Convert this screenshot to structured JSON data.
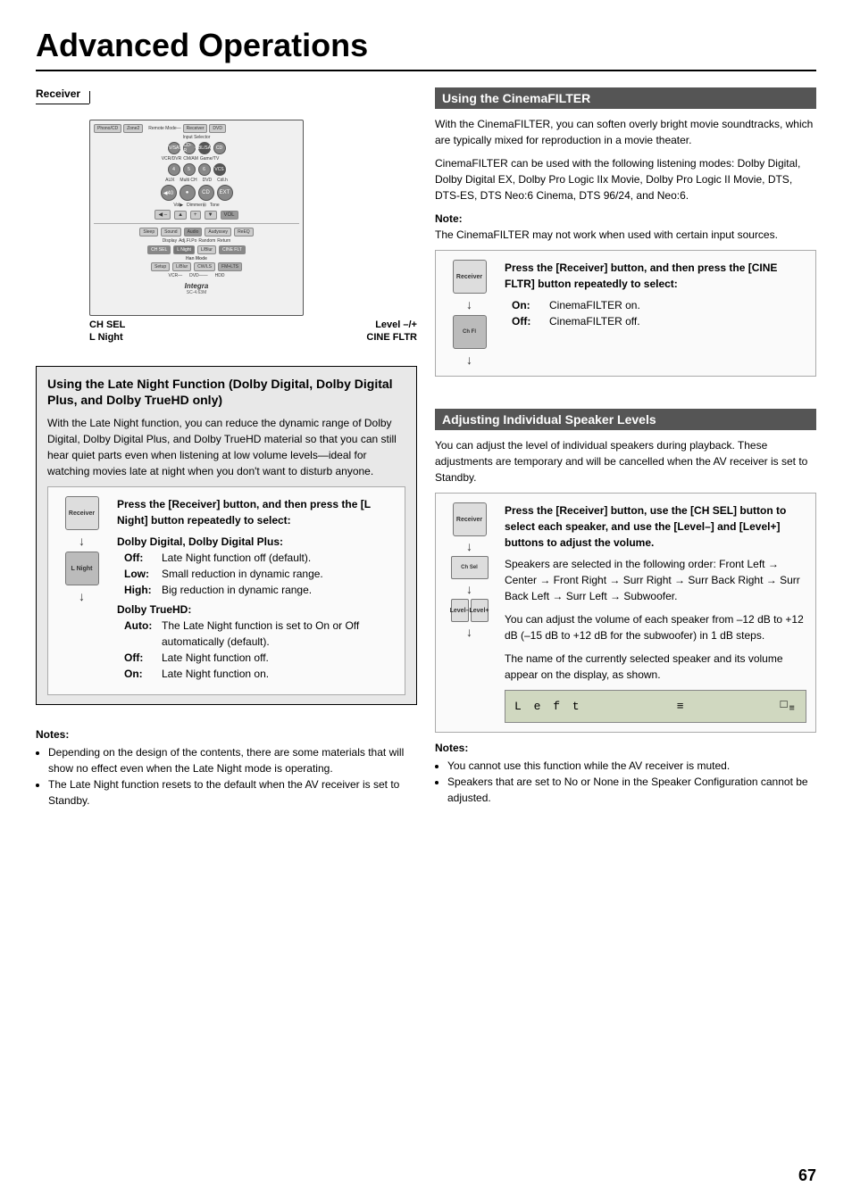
{
  "page": {
    "title": "Advanced Operations",
    "number": "67"
  },
  "receiver_diagram": {
    "receiver_label": "Receiver",
    "ch_sel": "CH SEL",
    "l_night": "L Night",
    "level": "Level –/+",
    "cine_fltr": "CINE FLTR"
  },
  "late_night_section": {
    "heading": "Using the Late Night Function (Dolby Digital, Dolby Digital Plus, and Dolby TrueHD only)",
    "body": "With the Late Night function, you can reduce the dynamic range of Dolby Digital, Dolby Digital Plus, and Dolby TrueHD material so that you can still hear quiet parts even when listening at low volume levels—ideal for watching movies late at night when you don't want to disturb anyone.",
    "instruction_main": "Press the [Receiver] button, and then press the [L Night] button repeatedly to select:",
    "dolby_digital_title": "Dolby Digital, Dolby Digital Plus:",
    "items_dd": [
      {
        "label": "Off:",
        "desc": "Late Night function off (default)."
      },
      {
        "label": "Low:",
        "desc": "Small reduction in dynamic range."
      },
      {
        "label": "High:",
        "desc": "Big reduction in dynamic range."
      }
    ],
    "dolby_truehd_title": "Dolby TrueHD:",
    "items_thd": [
      {
        "label": "Auto:",
        "desc": "The Late Night function is set to On or Off automatically (default)."
      },
      {
        "label": "Off:",
        "desc": "Late Night function off."
      },
      {
        "label": "On:",
        "desc": "Late Night function on."
      }
    ],
    "notes_title": "Notes:",
    "notes": [
      "Depending on the design of the contents, there are some materials that will show no effect even when the Late Night mode is operating.",
      "The Late Night function resets to the default when the AV receiver is set to Standby."
    ]
  },
  "cinemafilter_section": {
    "heading": "Using the CinemaFILTER",
    "body1": "With the CinemaFILTER, you can soften overly bright movie soundtracks, which are typically mixed for reproduction in a movie theater.",
    "body2": "CinemaFILTER can be used with the following listening modes: Dolby Digital, Dolby Digital EX, Dolby Pro Logic IIx Movie, Dolby Pro Logic II Movie, DTS, DTS-ES, DTS Neo:6 Cinema, DTS 96/24, and Neo:6.",
    "note_title": "Note:",
    "note_text": "The CinemaFILTER may not work when used with certain input sources.",
    "instruction_main": "Press the [Receiver] button, and then press the [CINE FLTR] button repeatedly to select:",
    "items": [
      {
        "label": "On:",
        "desc": "CinemaFILTER on."
      },
      {
        "label": "Off:",
        "desc": "CinemaFILTER off."
      }
    ]
  },
  "adj_speaker_section": {
    "heading": "Adjusting Individual Speaker Levels",
    "body": "You can adjust the level of individual speakers during playback. These adjustments are temporary and will be cancelled when the AV receiver is set to Standby.",
    "instruction_main": "Press the [Receiver] button, use the [CH SEL] button to select each speaker, and use the [Level–] and [Level+] buttons to adjust the volume.",
    "text1": "Speakers are selected in the following order: Front Left → Center → Front Right → Surr Right → Surr Back Right → Surr Back Left → Surr Left → Subwoofer.",
    "text2": "You can adjust the volume of each speaker from –12 dB to +12 dB (–15 dB to +12 dB for the subwoofer) in 1 dB steps.",
    "text3": "The name of the currently selected speaker and its volume appear on the display, as shown.",
    "display_text": "Left",
    "display_value": "0",
    "notes_title": "Notes:",
    "notes": [
      "You cannot use this function while the AV receiver is muted.",
      "Speakers that are set to No or None in the Speaker Configuration cannot be adjusted."
    ]
  },
  "icons": {
    "receiver_btn": "Receiver",
    "ch_sel_btn": "Ch Sel",
    "l_night_btn": "L Night",
    "level_minus_btn": "Level–",
    "level_plus_btn": "Level+"
  }
}
